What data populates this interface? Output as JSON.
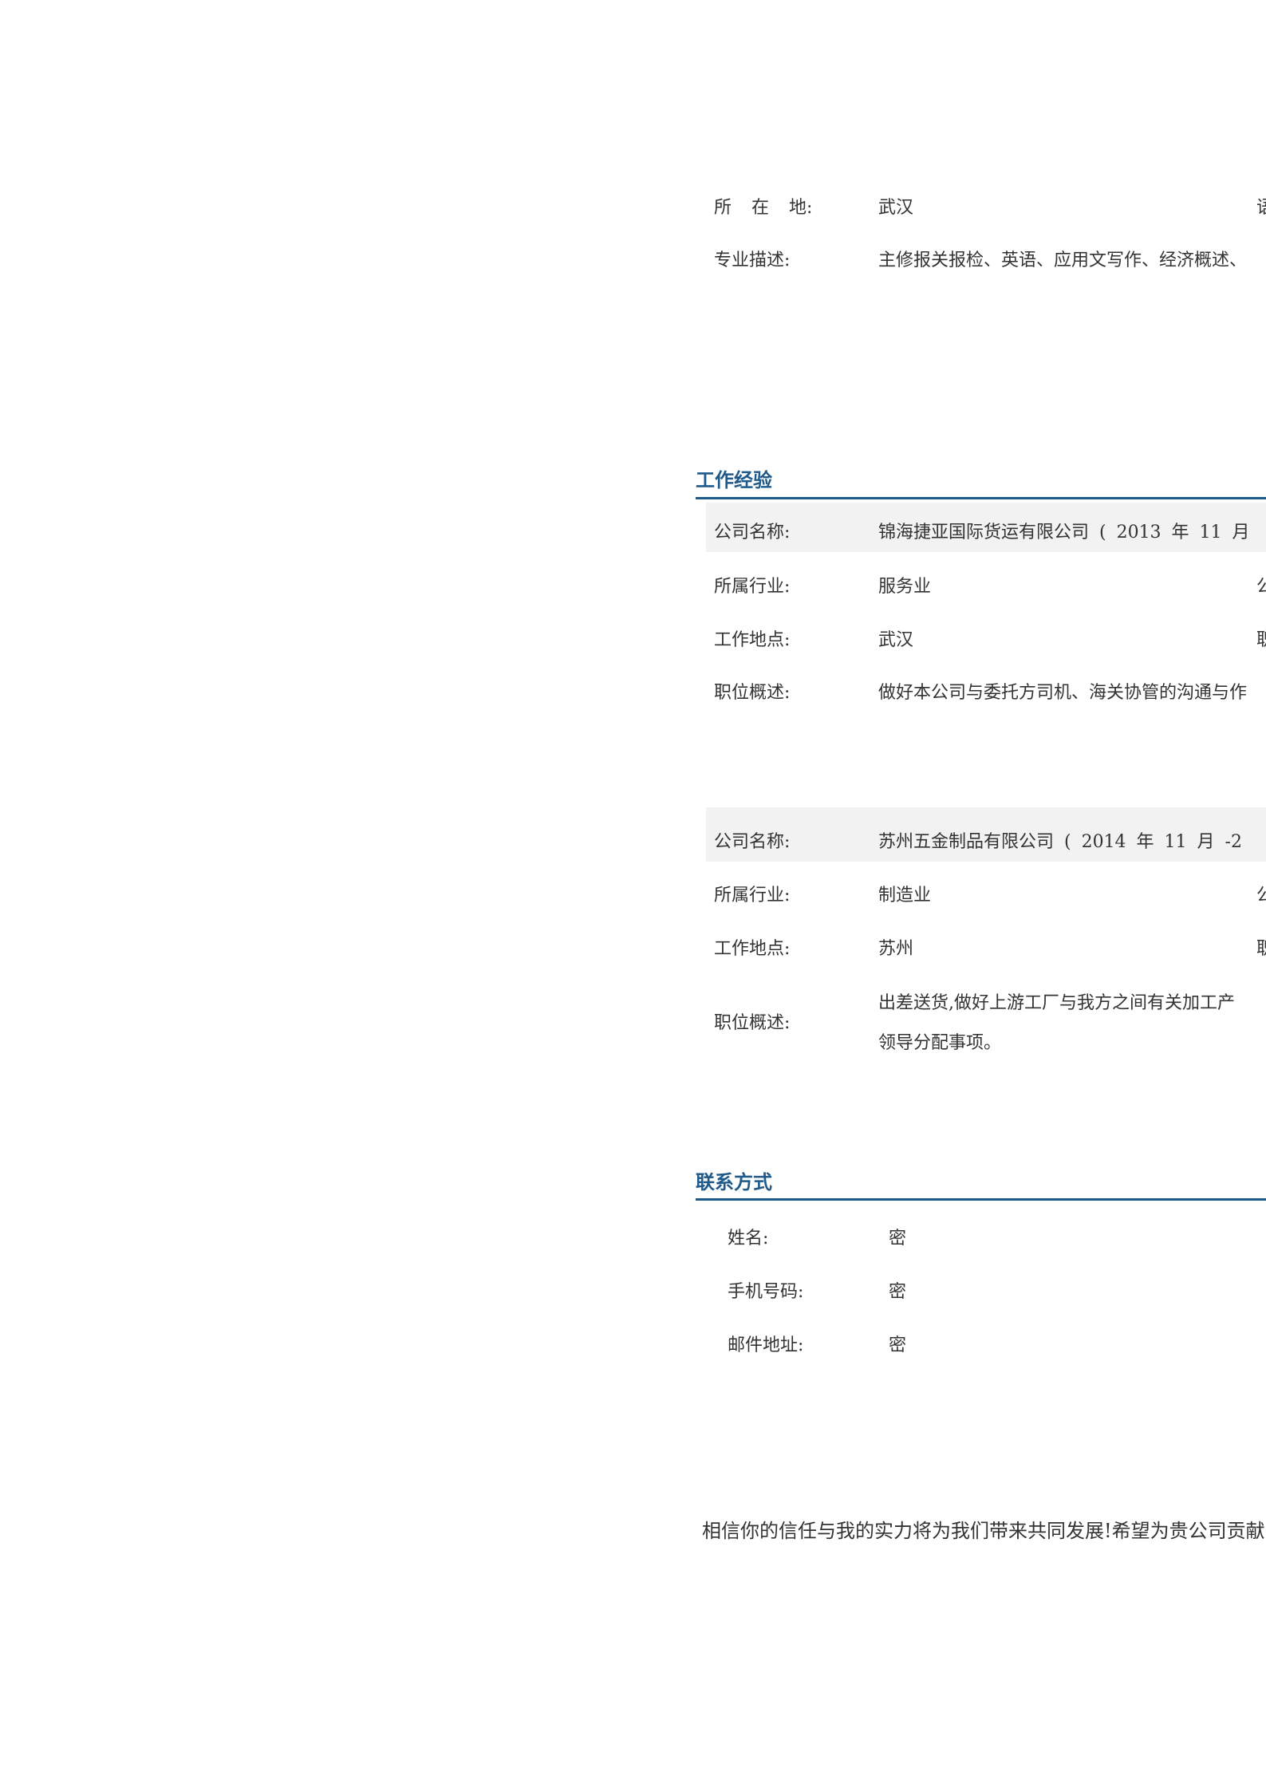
{
  "education": {
    "location_label": "所 在 地:",
    "location_value": "武汉",
    "location_right_fragment": "语",
    "major_label": "专业描述:",
    "major_value": "主修报关报检、英语、应用文写作、经济概述、"
  },
  "work_section": {
    "title": "工作经验",
    "jobs": [
      {
        "company_label": "公司名称:",
        "company_value": "锦海捷亚国际货运有限公司 ( 2013 年 11 月",
        "industry_label": "所属行业:",
        "industry_value": "服务业",
        "industry_right_fragment": "公",
        "location_label": "工作地点:",
        "location_value": "武汉",
        "location_right_fragment": "职",
        "desc_label": "职位概述:",
        "desc_line1": "做好本公司与委托方司机、海关协管的沟通与作"
      },
      {
        "company_label": "公司名称:",
        "company_value": "苏州五金制品有限公司 ( 2014 年 11 月 -2",
        "industry_label": "所属行业:",
        "industry_value": "制造业",
        "industry_right_fragment": "公",
        "location_label": "工作地点:",
        "location_value": "苏州",
        "location_right_fragment": "职",
        "desc_label": "职位概述:",
        "desc_line1": "出差送货,做好上游工厂与我方之间有关加工产",
        "desc_line2": "领导分配事项。"
      }
    ]
  },
  "contact_section": {
    "title": "联系方式",
    "name_label": "姓名:",
    "name_value": "密",
    "phone_label": "手机号码:",
    "phone_value": "密",
    "email_label": "邮件地址:",
    "email_value": "密"
  },
  "closing": {
    "text": "相信你的信任与我的实力将为我们带来共同发展!希望为贵公司贡献"
  }
}
